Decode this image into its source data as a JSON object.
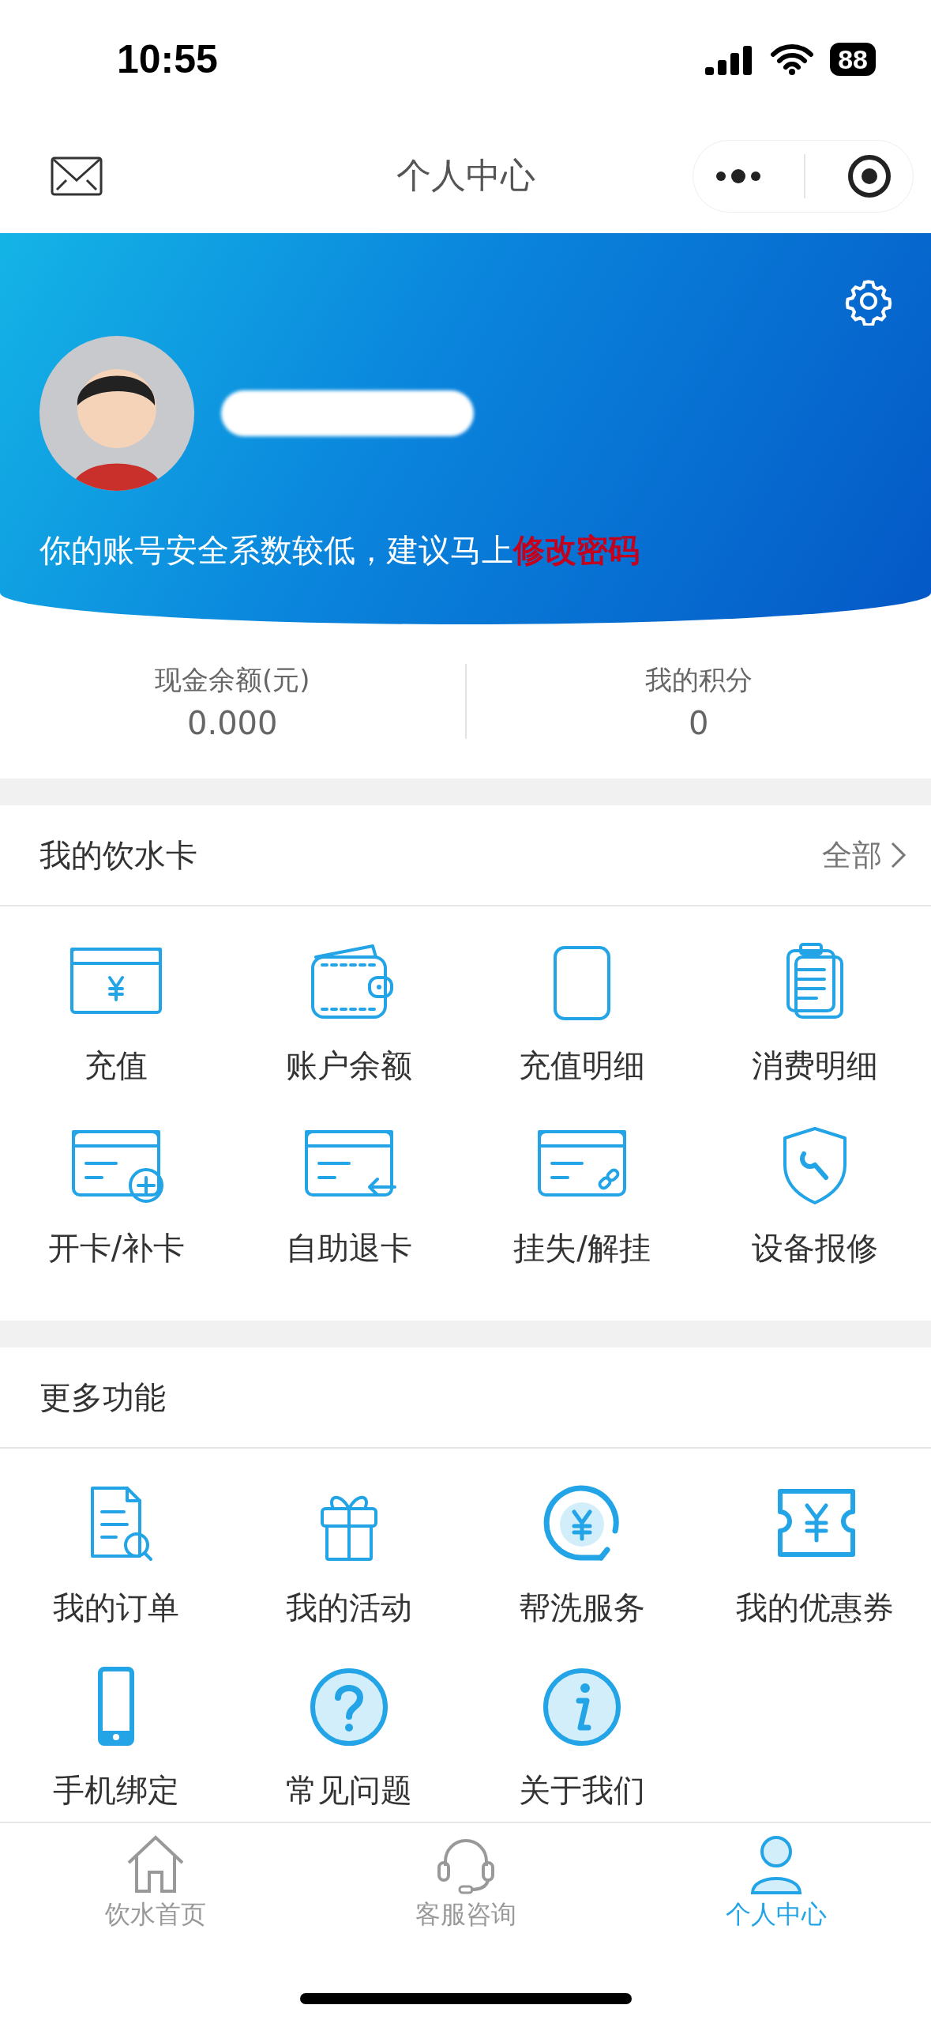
{
  "status_bar": {
    "time": "10:55",
    "battery": "88"
  },
  "nav": {
    "title": "个人中心"
  },
  "profile": {
    "notice": "你的账号安全系数较低，建议马上",
    "notice_link": "修改密码"
  },
  "stats": [
    {
      "label": "现金余额(元)",
      "value": "0.000"
    },
    {
      "label": "我的积分",
      "value": "0"
    }
  ],
  "sections": [
    {
      "title": "我的饮水卡",
      "more": "全部",
      "items": [
        "充值",
        "账户余额",
        "充值明细",
        "消费明细",
        "开卡/补卡",
        "自助退卡",
        "挂失/解挂",
        "设备报修"
      ]
    },
    {
      "title": "更多功能",
      "items": [
        "我的订单",
        "我的活动",
        "帮洗服务",
        "我的优惠券",
        "手机绑定",
        "常见问题",
        "关于我们"
      ]
    }
  ],
  "tab_bar": [
    {
      "label": "饮水首页",
      "selected": false
    },
    {
      "label": "客服咨询",
      "selected": false
    },
    {
      "label": "个人中心",
      "selected": true
    }
  ]
}
